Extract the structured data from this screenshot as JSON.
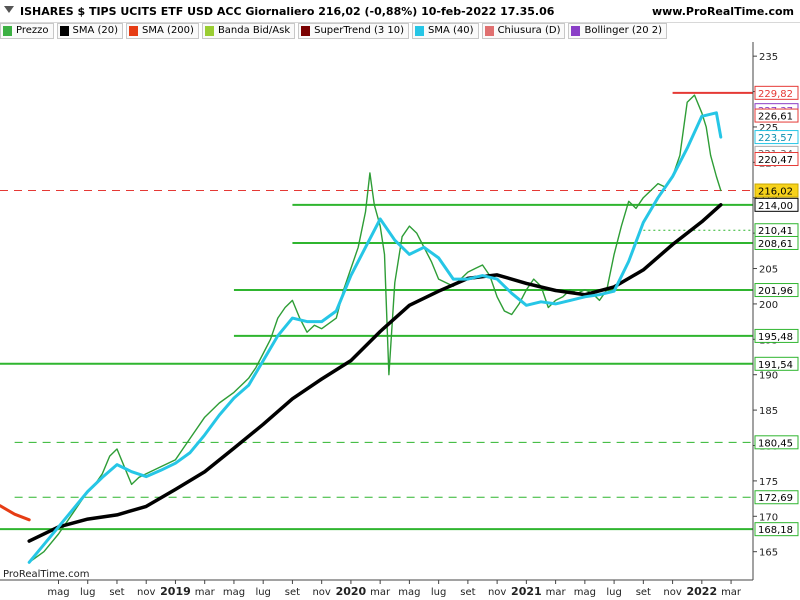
{
  "header": {
    "title": "ISHARES $ TIPS UCITS ETF USD ACC Giornaliero 216,02 (-0,88%) 10-feb-2022 17.35.06",
    "site": "www.ProRealTime.com"
  },
  "legend": [
    {
      "label": "Prezzo",
      "color": "#3cb043"
    },
    {
      "label": "SMA (20)",
      "color": "#000000"
    },
    {
      "label": "SMA (200)",
      "color": "#e63c14"
    },
    {
      "label": "Banda Bid/Ask",
      "color": "#9acd32"
    },
    {
      "label": "SuperTrend (3 10)",
      "color": "#7a0000"
    },
    {
      "label": "SMA (40)",
      "color": "#26c6e6"
    },
    {
      "label": "Chiusura (D)",
      "color": "#e07070"
    },
    {
      "label": "Bollinger (20 2)",
      "color": "#8a3fc7"
    }
  ],
  "watermark": "ProRealTime.com",
  "chart_data": {
    "type": "line",
    "title": "ISHARES $ TIPS UCITS ETF USD ACC Giornaliero 216,02 (-0,88%) 10-feb-2022 17.35.06",
    "ylim": [
      161,
      237
    ],
    "y_ticks": [
      165,
      170,
      175,
      180,
      185,
      190,
      195,
      200,
      205,
      210,
      215,
      220,
      225,
      230,
      235
    ],
    "y_tick_labels": [
      "165",
      "170",
      "175",
      "180",
      "185",
      "190",
      "195",
      "200",
      "205",
      "210",
      "215",
      "220",
      "225",
      "230",
      "235"
    ],
    "x_ticks": [
      {
        "label": "mag",
        "t": 4
      },
      {
        "label": "lug",
        "t": 6
      },
      {
        "label": "set",
        "t": 8
      },
      {
        "label": "nov",
        "t": 10
      },
      {
        "label": "2019",
        "t": 12
      },
      {
        "label": "mar",
        "t": 14
      },
      {
        "label": "mag",
        "t": 16
      },
      {
        "label": "lug",
        "t": 18
      },
      {
        "label": "set",
        "t": 20
      },
      {
        "label": "nov",
        "t": 22
      },
      {
        "label": "2020",
        "t": 24
      },
      {
        "label": "mar",
        "t": 26
      },
      {
        "label": "mag",
        "t": 28
      },
      {
        "label": "lug",
        "t": 30
      },
      {
        "label": "set",
        "t": 32
      },
      {
        "label": "nov",
        "t": 34
      },
      {
        "label": "2021",
        "t": 36
      },
      {
        "label": "mar",
        "t": 38
      },
      {
        "label": "mag",
        "t": 40
      },
      {
        "label": "lug",
        "t": 42
      },
      {
        "label": "set",
        "t": 44
      },
      {
        "label": "nov",
        "t": 46
      },
      {
        "label": "2022",
        "t": 48
      },
      {
        "label": "mar",
        "t": 50
      }
    ],
    "grid": false,
    "series": [
      {
        "name": "Prezzo",
        "color": "#2e9d36",
        "x": [
          2.0,
          3.0,
          4.0,
          5.0,
          5.5,
          6.0,
          6.5,
          7.0,
          7.5,
          8.0,
          8.5,
          9.0,
          9.5,
          10.0,
          11.0,
          12.0,
          12.5,
          13.0,
          14.0,
          15.0,
          16.0,
          17.0,
          17.5,
          18.0,
          18.5,
          19.0,
          19.5,
          20.0,
          20.5,
          21.0,
          21.5,
          22.0,
          23.0,
          23.5,
          24.0,
          24.5,
          25.0,
          25.3,
          25.6,
          26.0,
          26.3,
          26.6,
          27.0,
          27.5,
          28.0,
          28.5,
          29.0,
          29.5,
          30.0,
          31.0,
          31.5,
          32.0,
          32.5,
          33.0,
          33.5,
          34.0,
          34.5,
          35.0,
          35.5,
          36.0,
          36.5,
          37.0,
          37.5,
          38.0,
          38.5,
          39.0,
          39.5,
          40.0,
          40.5,
          41.0,
          41.5,
          42.0,
          42.5,
          43.0,
          43.5,
          44.0,
          45.0,
          45.5,
          46.0,
          46.5,
          47.0,
          47.5,
          48.0,
          48.3,
          48.6,
          49.0,
          49.3
        ],
        "values": [
          163.5,
          165.0,
          167.5,
          170.5,
          172.0,
          173.5,
          174.5,
          176.0,
          178.5,
          179.5,
          177.0,
          174.5,
          175.5,
          176.0,
          177.0,
          178.0,
          179.5,
          181.0,
          184.0,
          186.0,
          187.5,
          189.5,
          191.0,
          193.0,
          195.0,
          198.0,
          199.5,
          200.5,
          198.0,
          196.0,
          197.0,
          196.5,
          198.0,
          202.0,
          205.0,
          208.0,
          213.0,
          218.5,
          214.0,
          211.0,
          207.0,
          190.0,
          203.0,
          209.5,
          211.0,
          210.0,
          208.0,
          206.0,
          203.5,
          202.5,
          203.5,
          204.5,
          205.0,
          205.5,
          204.0,
          201.0,
          199.0,
          198.5,
          200.0,
          202.0,
          203.5,
          202.5,
          199.5,
          200.5,
          201.0,
          202.0,
          201.5,
          202.0,
          201.5,
          200.5,
          202.0,
          207.0,
          211.0,
          214.5,
          213.5,
          215.0,
          217.0,
          216.5,
          218.0,
          221.0,
          228.5,
          229.5,
          227.0,
          225.0,
          221.0,
          218.0,
          216.02
        ]
      },
      {
        "name": "SMA (20)",
        "color": "#000000",
        "x": [
          2,
          4,
          6,
          8,
          10,
          12,
          14,
          16,
          18,
          20,
          22,
          24,
          26,
          28,
          30,
          32,
          34,
          36,
          38,
          40,
          42,
          44,
          46,
          48,
          49.3
        ],
        "values": [
          166.5,
          168.5,
          169.6,
          170.2,
          171.4,
          173.8,
          176.3,
          179.6,
          183.0,
          186.6,
          189.4,
          192.0,
          196.1,
          199.8,
          201.8,
          203.6,
          204.1,
          202.9,
          201.9,
          201.3,
          202.4,
          204.8,
          208.4,
          211.6,
          214.0
        ]
      },
      {
        "name": "SMA (200)",
        "color": "#e63c14",
        "x": [
          0,
          1,
          2
        ],
        "values": [
          171.5,
          170.3,
          169.5
        ]
      },
      {
        "name": "SMA (40)",
        "color": "#26c6e6",
        "x": [
          2,
          3,
          4,
          5,
          6,
          7,
          8,
          9,
          10,
          11,
          12,
          13,
          14,
          15,
          16,
          17,
          18,
          19,
          20,
          21,
          22,
          23,
          24,
          25,
          26,
          27,
          28,
          29,
          30,
          31,
          32,
          33,
          34,
          35,
          36,
          37,
          38,
          39,
          40,
          41,
          42,
          43,
          44,
          45,
          46,
          47,
          48,
          49,
          49.3
        ],
        "values": [
          163.5,
          166.0,
          168.5,
          171.0,
          173.5,
          175.5,
          177.3,
          176.3,
          175.6,
          176.5,
          177.5,
          179.0,
          181.5,
          184.3,
          186.7,
          188.5,
          192.0,
          195.5,
          198.0,
          197.5,
          197.5,
          199.0,
          204.0,
          208.0,
          212.0,
          209.0,
          207.0,
          208.0,
          206.5,
          203.5,
          203.5,
          204.0,
          203.5,
          201.5,
          199.8,
          200.3,
          200.0,
          200.5,
          201.0,
          201.3,
          201.8,
          206.0,
          211.5,
          215.0,
          218.0,
          222.0,
          226.5,
          227.0,
          223.57
        ]
      }
    ],
    "price_labels": [
      {
        "value": 229.82,
        "label": "229,82"
      },
      {
        "value": 227.37,
        "label": "227,37"
      },
      {
        "value": 226.61,
        "label": "226,61"
      },
      {
        "value": 223.57,
        "label": "223,57"
      },
      {
        "value": 221.34,
        "label": "221,34"
      },
      {
        "value": 220.47,
        "label": "220,47"
      },
      {
        "value": 216.02,
        "label": "216,02"
      },
      {
        "value": 214.0,
        "label": "214,00"
      },
      {
        "value": 210.41,
        "label": "210,41"
      },
      {
        "value": 208.61,
        "label": "208,61"
      },
      {
        "value": 201.96,
        "label": "201,96"
      },
      {
        "value": 195.48,
        "label": "195,48"
      },
      {
        "value": 191.54,
        "label": "191,54"
      },
      {
        "value": 180.45,
        "label": "180,45"
      },
      {
        "value": 172.69,
        "label": "172,69"
      },
      {
        "value": 168.18,
        "label": "168,18"
      }
    ],
    "levels": [
      {
        "value": 214.0,
        "style": "solid",
        "color": "#2fb52f",
        "x_start": 20
      },
      {
        "value": 208.61,
        "style": "solid",
        "color": "#2fb52f",
        "x_start": 20
      },
      {
        "value": 201.96,
        "style": "solid",
        "color": "#2fb52f",
        "x_start": 16
      },
      {
        "value": 195.48,
        "style": "solid",
        "color": "#2fb52f",
        "x_start": 16
      },
      {
        "value": 191.54,
        "style": "solid",
        "color": "#2fb52f",
        "x_start": 0
      },
      {
        "value": 180.45,
        "style": "dashed",
        "color": "#2fb52f",
        "x_start": 1
      },
      {
        "value": 172.69,
        "style": "dashed",
        "color": "#2fb52f",
        "x_start": 1
      },
      {
        "value": 168.18,
        "style": "solid",
        "color": "#2fb52f",
        "x_start": 0
      },
      {
        "value": 210.41,
        "style": "dotted",
        "color": "#2fb52f",
        "x_start": 44
      },
      {
        "value": 216.02,
        "style": "dashed",
        "color": "#e53935",
        "x_start": 0
      },
      {
        "value": 229.82,
        "style": "solid",
        "color": "#e53935",
        "x_start": 46
      }
    ]
  }
}
